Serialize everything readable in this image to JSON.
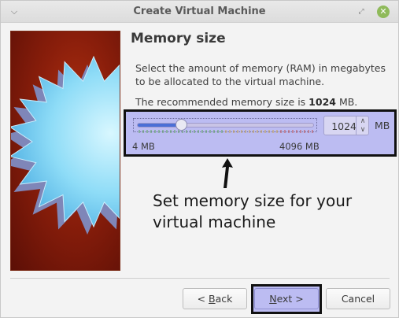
{
  "window": {
    "title": "Create Virtual Machine",
    "menu_icon": "chevron-down-icon",
    "restore_icon": "restore-icon",
    "close_icon": "close-icon",
    "close_color": "#8fba5a"
  },
  "page": {
    "heading": "Memory size",
    "description": "Select the amount of memory (RAM) in megabytes to be allocated to the virtual machine.",
    "recommend_prefix": "The recommended memory size is ",
    "recommend_value": "1024",
    "recommend_suffix": " MB."
  },
  "memory": {
    "value": "1024",
    "unit": "MB",
    "min_label": "4 MB",
    "max_label": "4096 MB",
    "slider_fraction": 0.25
  },
  "annotation": {
    "text": "Set memory size for your virtual machine"
  },
  "buttons": {
    "back_prefix": "< ",
    "back_mnemonic": "B",
    "back_rest": "ack",
    "next_mnemonic": "N",
    "next_rest": "ext >",
    "cancel": "Cancel"
  },
  "colors": {
    "highlight": "#bcbcf2",
    "slider_fill": "#4a6fd6"
  }
}
